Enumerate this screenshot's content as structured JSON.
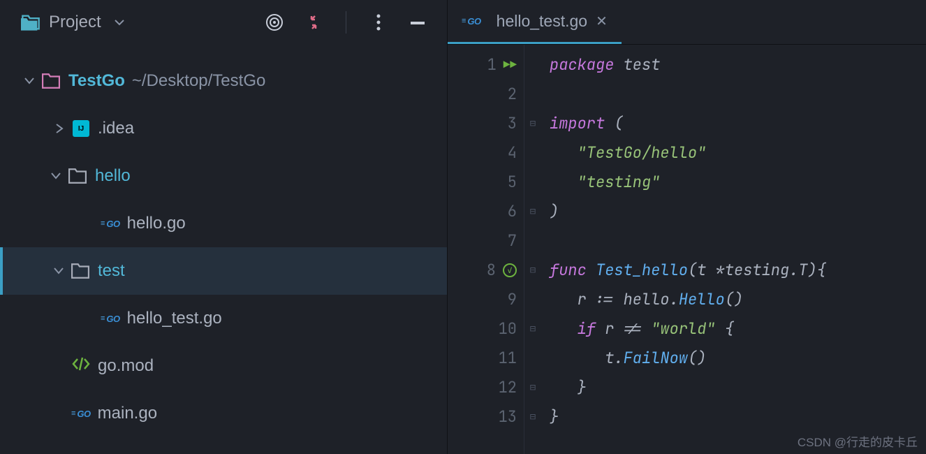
{
  "sidebar": {
    "title": "Project",
    "root": {
      "name": "TestGo",
      "path": "~/Desktop/TestGo"
    },
    "tree": [
      {
        "name": ".idea",
        "type": "idea",
        "indent": 78
      },
      {
        "name": "hello",
        "type": "folder",
        "indent": 72
      },
      {
        "name": "hello.go",
        "type": "go",
        "indent": 144
      },
      {
        "name": "test",
        "type": "folder",
        "indent": 72,
        "selected": true
      },
      {
        "name": "hello_test.go",
        "type": "go",
        "indent": 144
      },
      {
        "name": "go.mod",
        "type": "mod",
        "indent": 102
      },
      {
        "name": "main.go",
        "type": "go",
        "indent": 102
      }
    ]
  },
  "tab": {
    "name": "hello_test.go"
  },
  "code": {
    "lines": [
      {
        "n": 1,
        "run": true,
        "segs": [
          [
            "kw",
            "package "
          ],
          [
            "ident",
            "test"
          ]
        ]
      },
      {
        "n": 2,
        "segs": []
      },
      {
        "n": 3,
        "fold": "⊟",
        "segs": [
          [
            "kw",
            "import "
          ],
          [
            "ident",
            "("
          ]
        ]
      },
      {
        "n": 4,
        "segs": [
          [
            "ident",
            "   "
          ],
          [
            "str",
            "\"TestGo/hello\""
          ]
        ]
      },
      {
        "n": 5,
        "segs": [
          [
            "ident",
            "   "
          ],
          [
            "str",
            "\"testing\""
          ]
        ]
      },
      {
        "n": 6,
        "fold": "⊟",
        "segs": [
          [
            "ident",
            ")"
          ]
        ]
      },
      {
        "n": 7,
        "segs": []
      },
      {
        "n": 8,
        "check": true,
        "fold": "⊟",
        "segs": [
          [
            "kw",
            "func "
          ],
          [
            "func",
            "Test_hello"
          ],
          [
            "ident",
            "(t *testing.T){"
          ]
        ]
      },
      {
        "n": 9,
        "segs": [
          [
            "ident",
            "   r := hello."
          ],
          [
            "func",
            "Hello"
          ],
          [
            "ident",
            "()"
          ]
        ]
      },
      {
        "n": 10,
        "fold": "⊟",
        "segs": [
          [
            "ident",
            "   "
          ],
          [
            "kw",
            "if "
          ],
          [
            "ident",
            "r != "
          ],
          [
            "str",
            "\"world\""
          ],
          [
            "ident",
            " {"
          ]
        ]
      },
      {
        "n": 11,
        "segs": [
          [
            "ident",
            "      t."
          ],
          [
            "func",
            "FailNow"
          ],
          [
            "ident",
            "()"
          ]
        ]
      },
      {
        "n": 12,
        "fold": "⊟",
        "segs": [
          [
            "ident",
            "   }"
          ]
        ]
      },
      {
        "n": 13,
        "fold": "⊟",
        "segs": [
          [
            "ident",
            "}"
          ]
        ]
      }
    ]
  },
  "watermark": "CSDN @行走的皮卡丘"
}
